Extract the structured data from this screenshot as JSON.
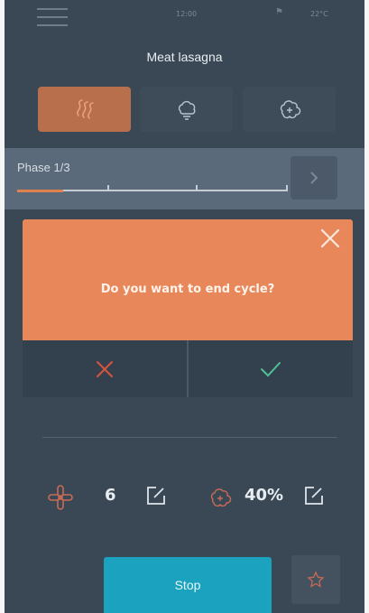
{
  "status_bar": {
    "time": "12:00",
    "temperature": "22°C",
    "icons": {
      "menu": "hamburger-menu-icon",
      "flag": "flag-icon"
    }
  },
  "recipe": {
    "title": "Meat lasagna"
  },
  "modes": [
    {
      "icon": "convection-heat-icon",
      "active": true
    },
    {
      "icon": "steam-icon",
      "active": false
    },
    {
      "icon": "combi-steam-icon",
      "active": false
    }
  ],
  "phase": {
    "label": "Phase 1/3",
    "progress": 0.17,
    "next_icon": "chevron-right-icon"
  },
  "dialog": {
    "message": "Do you want to end cycle?",
    "close_icon": "close-icon",
    "cancel_icon": "x-mark-icon",
    "confirm_icon": "checkmark-icon"
  },
  "settings": {
    "fan_speed": {
      "icon": "fan-icon",
      "value": "6"
    },
    "humidity": {
      "icon": "humidity-icon",
      "value": "40%"
    },
    "edit_icon": "edit-icon"
  },
  "actions": {
    "stop_label": "Stop",
    "favorite_icon": "star-icon"
  },
  "colors": {
    "background": "#3a4855",
    "accent": "#e8875a",
    "active_mode": "#b8704c",
    "stop": "#1aa2be",
    "cancel": "#d8543f",
    "confirm": "#4fc095"
  }
}
